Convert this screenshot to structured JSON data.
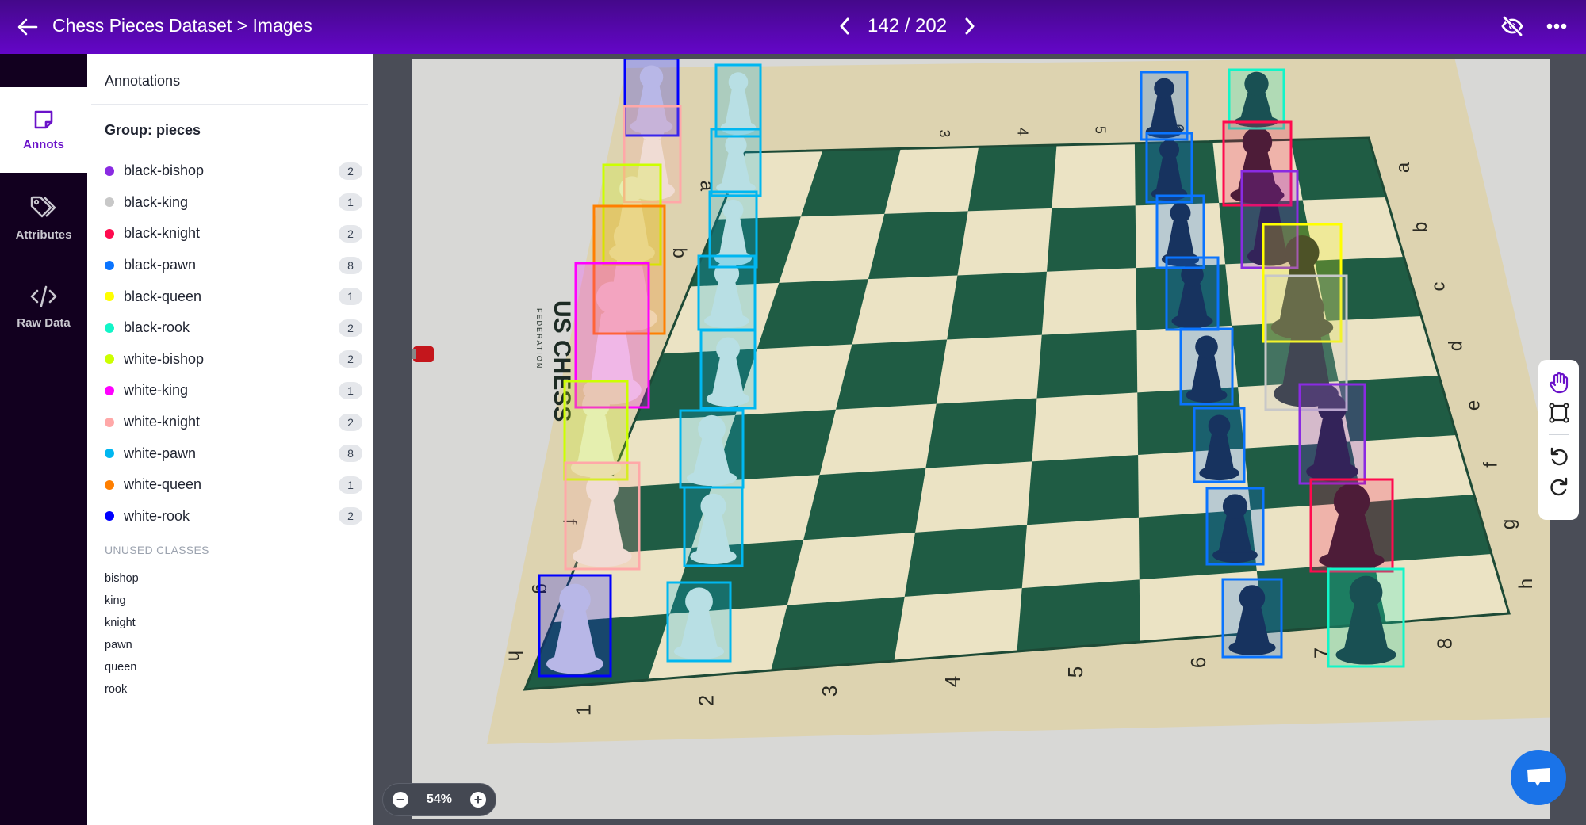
{
  "header": {
    "title": "Chess Pieces Dataset > Images",
    "pager": {
      "current": 142,
      "total": 202,
      "text": "142 / 202"
    },
    "icons": {
      "back": "arrow-left-icon",
      "prev": "chevron-left-icon",
      "next": "chevron-right-icon",
      "hide": "eye-off-icon",
      "more": "more-horizontal-icon"
    }
  },
  "rail": {
    "items": [
      {
        "label": "Annots",
        "icon": "sticky-note-icon",
        "active": true
      },
      {
        "label": "Attributes",
        "icon": "tags-icon",
        "active": false
      },
      {
        "label": "Raw Data",
        "icon": "code-icon",
        "active": false
      }
    ]
  },
  "panel": {
    "title": "Annotations",
    "group_title": "Group: pieces",
    "classes": [
      {
        "name": "black-bishop",
        "count": "2",
        "color": "#8a2be2"
      },
      {
        "name": "black-king",
        "count": "1",
        "color": "#c8c8c8"
      },
      {
        "name": "black-knight",
        "count": "2",
        "color": "#ff0a4e"
      },
      {
        "name": "black-pawn",
        "count": "8",
        "color": "#0a74ff"
      },
      {
        "name": "black-queen",
        "count": "1",
        "color": "#ffff00"
      },
      {
        "name": "black-rook",
        "count": "2",
        "color": "#11f5c8"
      },
      {
        "name": "white-bishop",
        "count": "2",
        "color": "#ccff00"
      },
      {
        "name": "white-king",
        "count": "1",
        "color": "#ff00ff"
      },
      {
        "name": "white-knight",
        "count": "2",
        "color": "#ffa8a8"
      },
      {
        "name": "white-pawn",
        "count": "8",
        "color": "#00b7f0"
      },
      {
        "name": "white-queen",
        "count": "1",
        "color": "#ff7f00"
      },
      {
        "name": "white-rook",
        "count": "2",
        "color": "#0000ff"
      }
    ],
    "unused_title": "UNUSED CLASSES",
    "unused": [
      "bishop",
      "king",
      "knight",
      "pawn",
      "queen",
      "rook"
    ]
  },
  "image": {
    "board_brand": "US CHESS",
    "board_brand_sub": "FEDERATION",
    "file_labels": [
      "a",
      "b",
      "c",
      "d",
      "e",
      "f",
      "g",
      "h"
    ],
    "rank_labels": [
      "1",
      "2",
      "3",
      "4",
      "5",
      "6",
      "7",
      "8"
    ]
  },
  "zoom": {
    "value": "54%",
    "minus_icon": "zoom-out-icon",
    "plus_icon": "zoom-in-icon"
  },
  "toolbar": {
    "tools": [
      "pan-hand-icon",
      "bounding-box-icon",
      "undo-icon",
      "redo-icon"
    ],
    "active_tool": "pan-hand-icon"
  },
  "chat": {
    "icon": "chat-bubble-icon"
  },
  "colors": {
    "accent": "#6a12c9",
    "header_start": "#44088a",
    "header_end": "#6406c8",
    "rail": "#12001f"
  }
}
